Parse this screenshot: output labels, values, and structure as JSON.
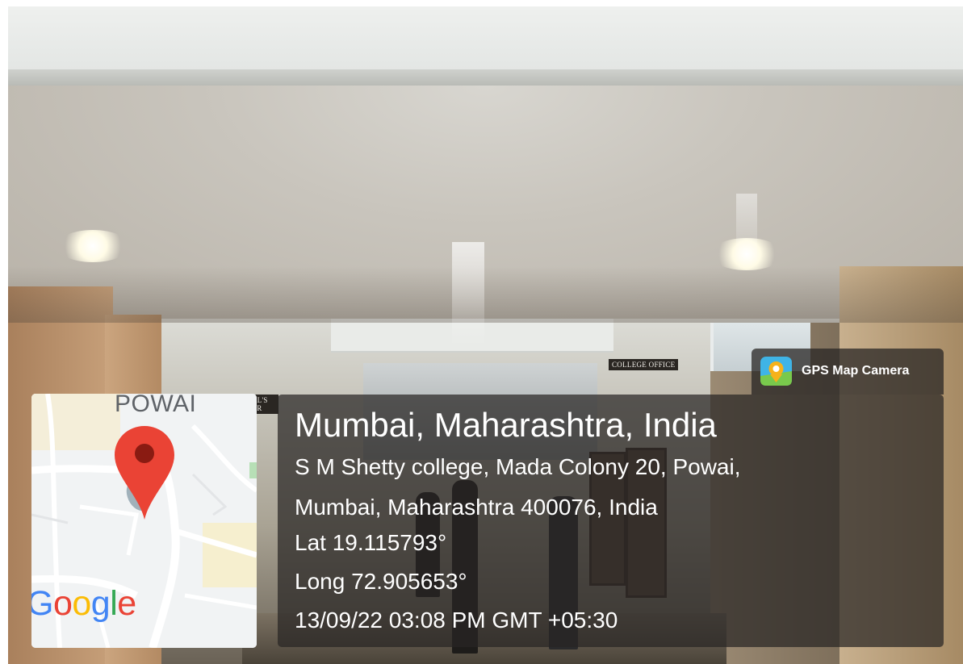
{
  "background_signs": {
    "college_office": "COLLEGE OFFICE",
    "principal_line1": "NCIPAL'S",
    "principal_line2": "AMBER"
  },
  "badge": {
    "label": "GPS Map Camera",
    "icon": "gps-map-camera-app-icon"
  },
  "map": {
    "area_label": "POWAI",
    "logo_letters": [
      "G",
      "o",
      "o",
      "g",
      "l",
      "e"
    ],
    "logo_colors": [
      "#4285F4",
      "#EA4335",
      "#FBBC05",
      "#4285F4",
      "#34A853",
      "#EA4335"
    ],
    "pin_color": "#EA4335",
    "icon": "location-pin-icon"
  },
  "info": {
    "title": "Mumbai, Maharashtra, India",
    "address_line1": "S M Shetty college, Mada Colony 20, Powai,",
    "address_line2": "Mumbai, Maharashtra 400076, India",
    "latitude": "Lat 19.115793°",
    "longitude": "Long 72.905653°",
    "timestamp": "13/09/22 03:08 PM GMT +05:30"
  },
  "colors": {
    "panel_bg": "#282624",
    "text": "#ffffff",
    "map_bg": "#f1f3f4"
  }
}
